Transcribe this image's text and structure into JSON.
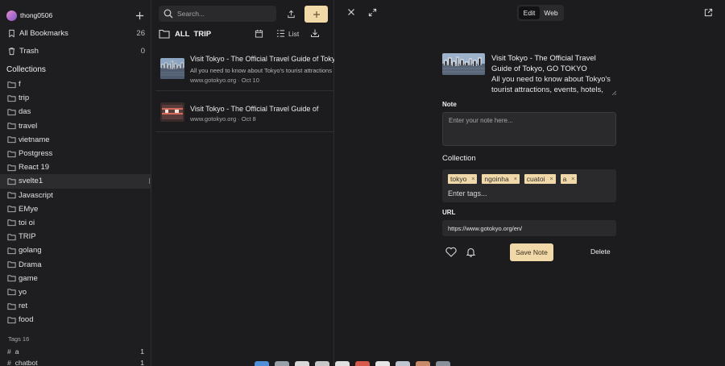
{
  "sidebar": {
    "username": "thong0506",
    "all_bookmarks": {
      "label": "All Bookmarks",
      "count": "26"
    },
    "trash": {
      "label": "Trash",
      "count": "0"
    },
    "collections_title": "Collections",
    "collections": [
      {
        "label": "f"
      },
      {
        "label": "trip"
      },
      {
        "label": "das"
      },
      {
        "label": "travel"
      },
      {
        "label": "vietname"
      },
      {
        "label": "Postgress"
      },
      {
        "label": "React 19"
      },
      {
        "label": "svelte1"
      },
      {
        "label": "Javascript"
      },
      {
        "label": "EMye"
      },
      {
        "label": "toi oi"
      },
      {
        "label": "TRIP"
      },
      {
        "label": "golang"
      },
      {
        "label": "Drama"
      },
      {
        "label": "game"
      },
      {
        "label": "yo"
      },
      {
        "label": "ret"
      },
      {
        "label": "food"
      }
    ],
    "tags_title": "Tags 16",
    "tags": [
      {
        "label": "a",
        "count": "1"
      },
      {
        "label": "chatbot",
        "count": "1"
      }
    ]
  },
  "middle": {
    "search_placeholder": "Search...",
    "breadcrumb": {
      "all": "All",
      "current": "TRIP"
    },
    "view_label": "List",
    "bookmarks": [
      {
        "title": "Visit Tokyo - The Official Travel Guide of Tokyo",
        "description": "All you need to know about Tokyo's tourist attractions",
        "meta": "www.gotokyo.org · Oct 10"
      },
      {
        "title": "Visit Tokyo - The Official Travel Guide of",
        "description": "",
        "meta": "www.gotokyo.org · Oct 8"
      }
    ]
  },
  "detail": {
    "tabs": {
      "edit": "Edit",
      "web": "Web"
    },
    "title": "Visit Tokyo - The Official Travel Guide of Tokyo, GO TOKYO",
    "description": "All you need to know about Tokyo's tourist attractions, events, hotels, transportation",
    "note_label": "Note",
    "note_placeholder": "Enter your note here...",
    "collection_label": "Collection",
    "tags": [
      "tokyo",
      "ngoinha",
      "cuatoi",
      "a"
    ],
    "tag_remove_glyph": "×",
    "tag_input_placeholder": "Enter tags...",
    "url_label": "URL",
    "url_value": "https://www.gotokyo.org/en/",
    "save_label": "Save Note",
    "delete_label": "Delete"
  },
  "colors": {
    "background": "#1c1c1e",
    "accent": "#f0d8a8",
    "panel": "#2a2a2d"
  },
  "icons": {
    "user_action": "plus-icon",
    "bookmarks": "bookmark-icon",
    "trash": "trash-icon",
    "folder": "folder-icon",
    "tag": "hash-icon",
    "upload": "upload-icon",
    "download": "download-icon",
    "calendar": "calendar-icon",
    "view": "list-icon",
    "close": "close-icon",
    "expand": "expand-icon",
    "external": "external-link-icon",
    "favorite": "heart-icon",
    "reminder": "bell-icon"
  }
}
